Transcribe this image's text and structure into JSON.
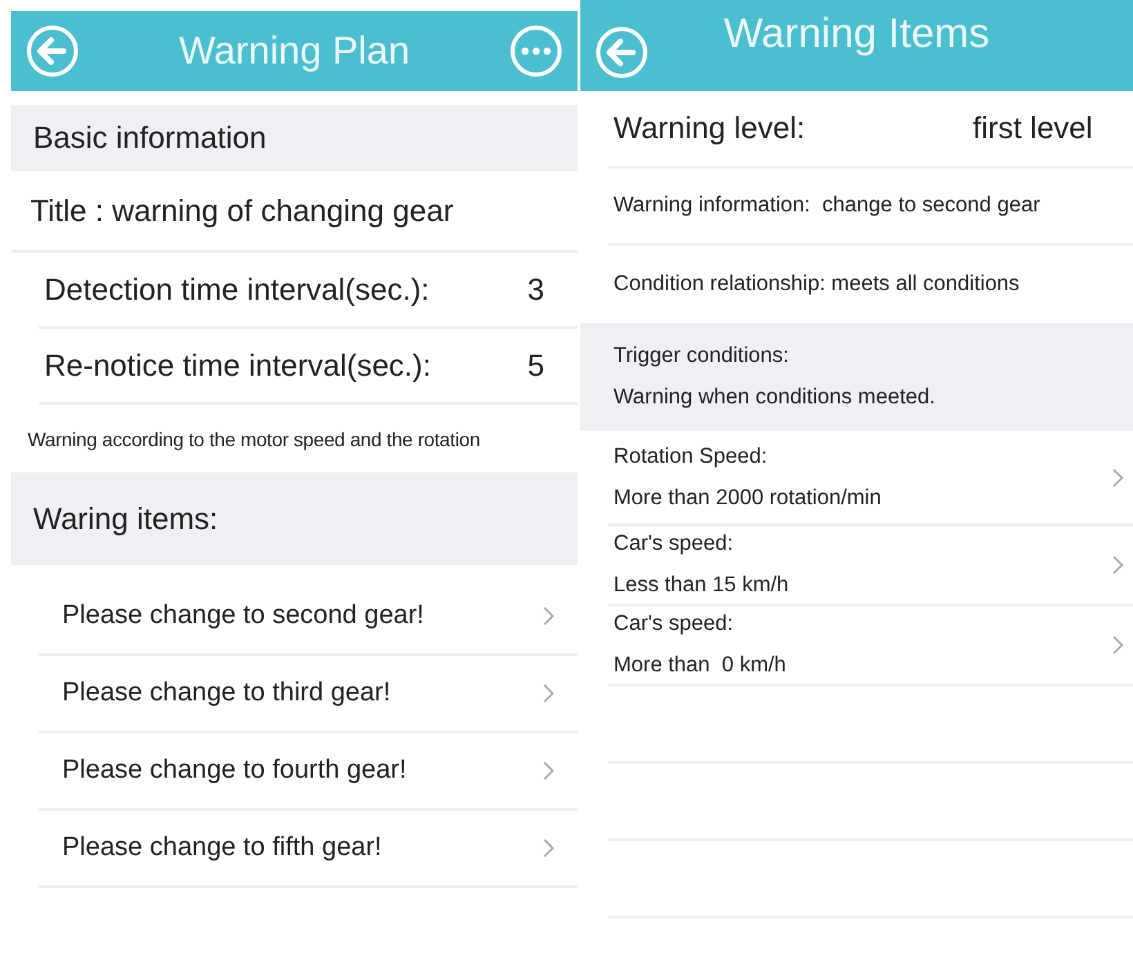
{
  "screens": [
    {
      "header": {
        "title": "Warning Plan",
        "has_more": true
      },
      "sections": [
        {
          "kind": "group",
          "label": "Basic information"
        },
        {
          "kind": "title",
          "label": "Title : warning of changing gear"
        },
        {
          "kind": "field",
          "label": "Detection time interval(sec.):",
          "value": "3"
        },
        {
          "kind": "field",
          "label": "Re-notice time interval(sec.):",
          "value": "5"
        },
        {
          "kind": "note",
          "label": "Warning according to the motor speed and the rotation"
        },
        {
          "kind": "group",
          "label": "Waring items:"
        },
        {
          "kind": "link",
          "label": "Please change to second gear!"
        },
        {
          "kind": "link",
          "label": "Please change to third gear!"
        },
        {
          "kind": "link",
          "label": "Please change to fourth gear!"
        },
        {
          "kind": "link",
          "label": "Please change to fifth gear!"
        }
      ]
    },
    {
      "header": {
        "title": "Warning Items",
        "has_more": false
      },
      "sections": [
        {
          "kind": "level",
          "label": "Warning level:",
          "value": "first level"
        },
        {
          "kind": "info",
          "label": "Warning information:  change to second gear"
        },
        {
          "kind": "info",
          "label": "Condition relationship: meets all conditions"
        },
        {
          "kind": "trigger",
          "label": "Trigger conditions:",
          "value": "Warning when conditions meeted."
        },
        {
          "kind": "condition",
          "label": "Rotation Speed:",
          "value": "More than 2000 rotation/min"
        },
        {
          "kind": "condition",
          "label": "Car's speed:",
          "value": "Less than 15 km/h"
        },
        {
          "kind": "condition",
          "label": "Car's speed:",
          "value": "More than  0 km/h"
        },
        {
          "kind": "empty"
        },
        {
          "kind": "empty"
        },
        {
          "kind": "empty"
        }
      ]
    }
  ]
}
